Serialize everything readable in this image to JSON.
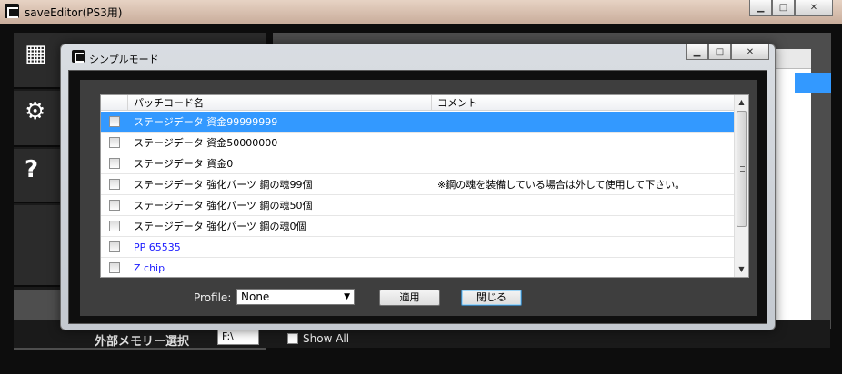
{
  "main": {
    "title": "saveEditor(PS3用)",
    "ext_mem_label": "外部メモリー選択",
    "ext_mem_value": "F:\\",
    "show_all": "Show All"
  },
  "dialog": {
    "title": "シンプルモード",
    "columns": {
      "name": "パッチコード名",
      "comment": "コメント"
    },
    "rows": [
      {
        "name": "ステージデータ 資金99999999",
        "comment": "",
        "selected": true
      },
      {
        "name": "ステージデータ 資金50000000",
        "comment": ""
      },
      {
        "name": "ステージデータ 資金0",
        "comment": ""
      },
      {
        "name": "ステージデータ 強化パーツ 鋼の魂99個",
        "comment": "※鋼の魂を装備している場合は外して使用して下さい。"
      },
      {
        "name": "ステージデータ 強化パーツ 鋼の魂50個",
        "comment": ""
      },
      {
        "name": "ステージデータ 強化パーツ 鋼の魂0個",
        "comment": ""
      },
      {
        "name": "PP 65535",
        "comment": ""
      },
      {
        "name": "Z chip",
        "comment": ""
      }
    ],
    "profile_label": "Profile:",
    "profile_value": "None",
    "apply_label": "適用",
    "close_label": "閉じる"
  }
}
